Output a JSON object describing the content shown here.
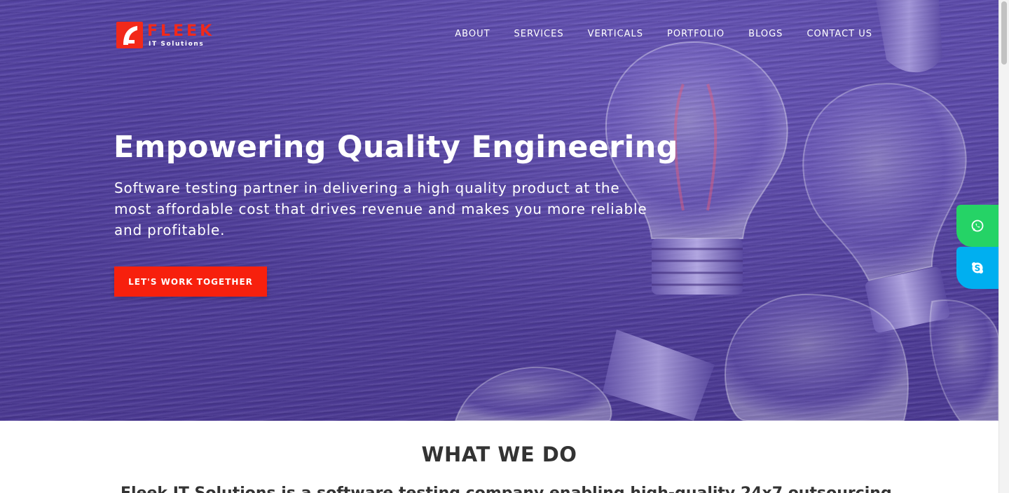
{
  "brand": {
    "name": "FLEEK",
    "tagline": "IT Solutions",
    "accent_color": "#f2291a"
  },
  "nav": {
    "items": [
      {
        "label": "ABOUT"
      },
      {
        "label": "SERVICES"
      },
      {
        "label": "VERTICALS"
      },
      {
        "label": "PORTFOLIO"
      },
      {
        "label": "BLOGS"
      },
      {
        "label": "CONTACT US"
      }
    ]
  },
  "hero": {
    "title": "Empowering Quality Engineering",
    "subtitle": "Software testing partner in delivering a high quality product at the most affordable cost that drives revenue and makes you more reliable and profitable.",
    "cta_label": "LET'S WORK TOGETHER",
    "overlay_color": "#4e3c98",
    "cta_color": "#f7200d"
  },
  "floating_contacts": [
    {
      "icon": "whatsapp-icon",
      "color": "#25d366"
    },
    {
      "icon": "skype-icon",
      "color": "#00aff0"
    }
  ],
  "section": {
    "title": "WHAT WE DO",
    "intro": "Fleek IT Solutions is a software testing company enabling high-quality 24x7 outsourcing"
  }
}
